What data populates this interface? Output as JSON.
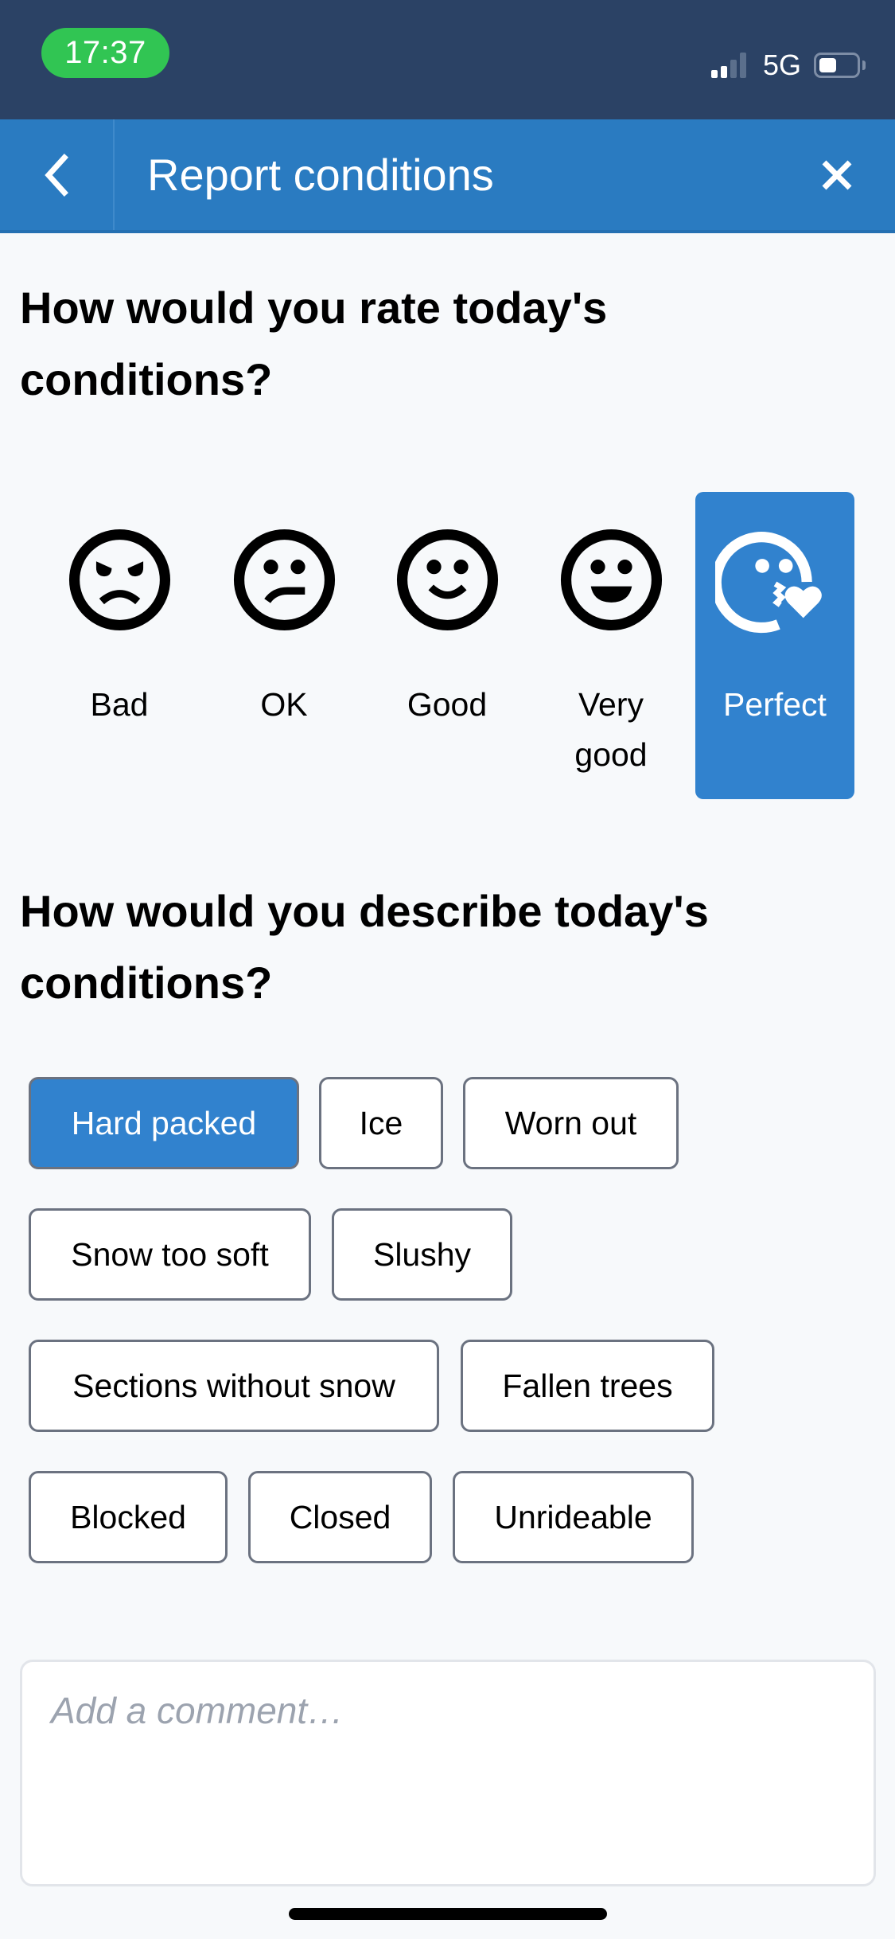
{
  "status_bar": {
    "time": "17:37",
    "network": "5G",
    "signal_bars_active": 2,
    "signal_bars_total": 4,
    "battery_level": 0.45
  },
  "header": {
    "title": "Report conditions",
    "back_icon": "chevron-left-icon",
    "close_icon": "close-icon"
  },
  "rating": {
    "question": "How would you rate today's conditions?",
    "selected": "Perfect",
    "options": [
      {
        "label": "Bad",
        "icon": "angry-face-icon",
        "selected": false
      },
      {
        "label": "OK",
        "icon": "neutral-face-icon",
        "selected": false
      },
      {
        "label": "Good",
        "icon": "smile-face-icon",
        "selected": false
      },
      {
        "label": "Very good",
        "icon": "grin-face-icon",
        "selected": false
      },
      {
        "label": "Perfect",
        "icon": "kiss-heart-face-icon",
        "selected": true
      }
    ]
  },
  "description": {
    "question": "How would you describe today's conditions?",
    "chips": [
      {
        "label": "Hard packed",
        "selected": true
      },
      {
        "label": "Ice",
        "selected": false
      },
      {
        "label": "Worn out",
        "selected": false
      },
      {
        "label": "Snow too soft",
        "selected": false
      },
      {
        "label": "Slushy",
        "selected": false
      },
      {
        "label": "Sections without snow",
        "selected": false
      },
      {
        "label": "Fallen trees",
        "selected": false
      },
      {
        "label": "Blocked",
        "selected": false
      },
      {
        "label": "Closed",
        "selected": false
      },
      {
        "label": "Unrideable",
        "selected": false
      }
    ]
  },
  "comment": {
    "value": "",
    "placeholder": "Add a comment…"
  },
  "colors": {
    "status_bar": "#2B4265",
    "header": "#2A7BC1",
    "accent": "#3182CE",
    "time_pill": "#31C553",
    "chip_border": "#6B7280",
    "background": "#F7F9FB"
  }
}
